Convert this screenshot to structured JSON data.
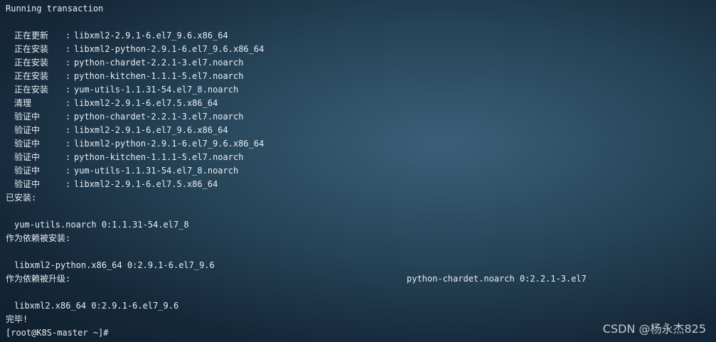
{
  "terminal": {
    "header": "Running transaction",
    "transactions": [
      {
        "status": "正在更新",
        "package": "libxml2-2.9.1-6.el7_9.6.x86_64"
      },
      {
        "status": "正在安装",
        "package": "libxml2-python-2.9.1-6.el7_9.6.x86_64"
      },
      {
        "status": "正在安装",
        "package": "python-chardet-2.2.1-3.el7.noarch"
      },
      {
        "status": "正在安装",
        "package": "python-kitchen-1.1.1-5.el7.noarch"
      },
      {
        "status": "正在安装",
        "package": "yum-utils-1.1.31-54.el7_8.noarch"
      },
      {
        "status": "清理",
        "package": "libxml2-2.9.1-6.el7.5.x86_64"
      },
      {
        "status": "验证中",
        "package": "python-chardet-2.2.1-3.el7.noarch"
      },
      {
        "status": "验证中",
        "package": "libxml2-2.9.1-6.el7_9.6.x86_64"
      },
      {
        "status": "验证中",
        "package": "libxml2-python-2.9.1-6.el7_9.6.x86_64"
      },
      {
        "status": "验证中",
        "package": "python-kitchen-1.1.1-5.el7.noarch"
      },
      {
        "status": "验证中",
        "package": "yum-utils-1.1.31-54.el7_8.noarch"
      },
      {
        "status": "验证中",
        "package": "libxml2-2.9.1-6.el7.5.x86_64"
      }
    ],
    "installed": {
      "title": "已安装:",
      "items": [
        "yum-utils.noarch 0:1.1.31-54.el7_8"
      ]
    },
    "dep_installed": {
      "title": "作为依赖被安装:",
      "items": [
        "libxml2-python.x86_64 0:2.9.1-6.el7_9.6",
        "python-chardet.noarch 0:2.2.1-3.el7"
      ]
    },
    "dep_updated": {
      "title": "作为依赖被升级:",
      "items": [
        "libxml2.x86_64 0:2.9.1-6.el7_9.6"
      ]
    },
    "complete": "完毕!",
    "prompt": "[root@K8S-master ~]#"
  },
  "watermark": "CSDN @杨永杰825",
  "colors": {
    "background": "#274559",
    "text": "#e9eef2"
  }
}
